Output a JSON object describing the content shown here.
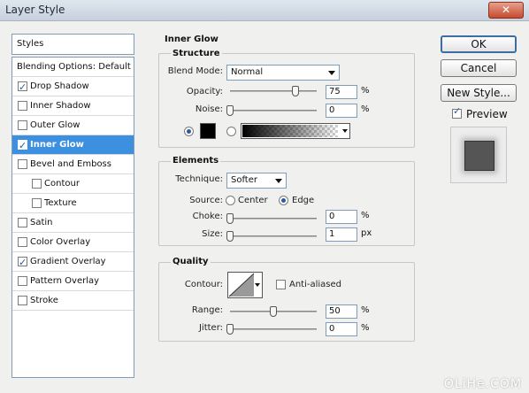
{
  "window": {
    "title": "Layer Style",
    "close_glyph": "✕"
  },
  "styles_panel": {
    "header": "Styles",
    "items": [
      {
        "label": "Blending Options: Default",
        "has_checkbox": false,
        "checked": false,
        "selected": false,
        "indent": 0
      },
      {
        "label": "Drop Shadow",
        "has_checkbox": true,
        "checked": true,
        "selected": false,
        "indent": 0
      },
      {
        "label": "Inner Shadow",
        "has_checkbox": true,
        "checked": false,
        "selected": false,
        "indent": 0
      },
      {
        "label": "Outer Glow",
        "has_checkbox": true,
        "checked": false,
        "selected": false,
        "indent": 0
      },
      {
        "label": "Inner Glow",
        "has_checkbox": true,
        "checked": true,
        "selected": true,
        "indent": 0
      },
      {
        "label": "Bevel and Emboss",
        "has_checkbox": true,
        "checked": false,
        "selected": false,
        "indent": 0
      },
      {
        "label": "Contour",
        "has_checkbox": true,
        "checked": false,
        "selected": false,
        "indent": 1
      },
      {
        "label": "Texture",
        "has_checkbox": true,
        "checked": false,
        "selected": false,
        "indent": 1
      },
      {
        "label": "Satin",
        "has_checkbox": true,
        "checked": false,
        "selected": false,
        "indent": 0
      },
      {
        "label": "Color Overlay",
        "has_checkbox": true,
        "checked": false,
        "selected": false,
        "indent": 0
      },
      {
        "label": "Gradient Overlay",
        "has_checkbox": true,
        "checked": true,
        "selected": false,
        "indent": 0
      },
      {
        "label": "Pattern Overlay",
        "has_checkbox": true,
        "checked": false,
        "selected": false,
        "indent": 0
      },
      {
        "label": "Stroke",
        "has_checkbox": true,
        "checked": false,
        "selected": false,
        "indent": 0
      }
    ]
  },
  "inner_glow": {
    "title": "Inner Glow",
    "structure": {
      "title": "Structure",
      "blend_mode_label": "Blend Mode:",
      "blend_mode_value": "Normal",
      "opacity_label": "Opacity:",
      "opacity_value": "75",
      "opacity_unit": "%",
      "opacity_fraction": 0.75,
      "noise_label": "Noise:",
      "noise_value": "0",
      "noise_unit": "%",
      "noise_fraction": 0,
      "color_radio_selected": true,
      "gradient_radio_selected": false,
      "glow_color": "#000000"
    },
    "elements": {
      "title": "Elements",
      "technique_label": "Technique:",
      "technique_value": "Softer",
      "source_label": "Source:",
      "source_center_label": "Center",
      "source_edge_label": "Edge",
      "source_selected": "Edge",
      "choke_label": "Choke:",
      "choke_value": "0",
      "choke_unit": "%",
      "choke_fraction": 0,
      "size_label": "Size:",
      "size_value": "1",
      "size_unit": "px",
      "size_fraction": 0.004
    },
    "quality": {
      "title": "Quality",
      "contour_label": "Contour:",
      "anti_aliased_label": "Anti-aliased",
      "anti_aliased_checked": false,
      "range_label": "Range:",
      "range_value": "50",
      "range_unit": "%",
      "range_fraction": 0.5,
      "jitter_label": "Jitter:",
      "jitter_value": "0",
      "jitter_unit": "%",
      "jitter_fraction": 0
    }
  },
  "buttons": {
    "ok": "OK",
    "cancel": "Cancel",
    "new_style": "New Style...",
    "preview_label": "Preview",
    "preview_checked": true
  },
  "watermark": "OLiHe.COM"
}
